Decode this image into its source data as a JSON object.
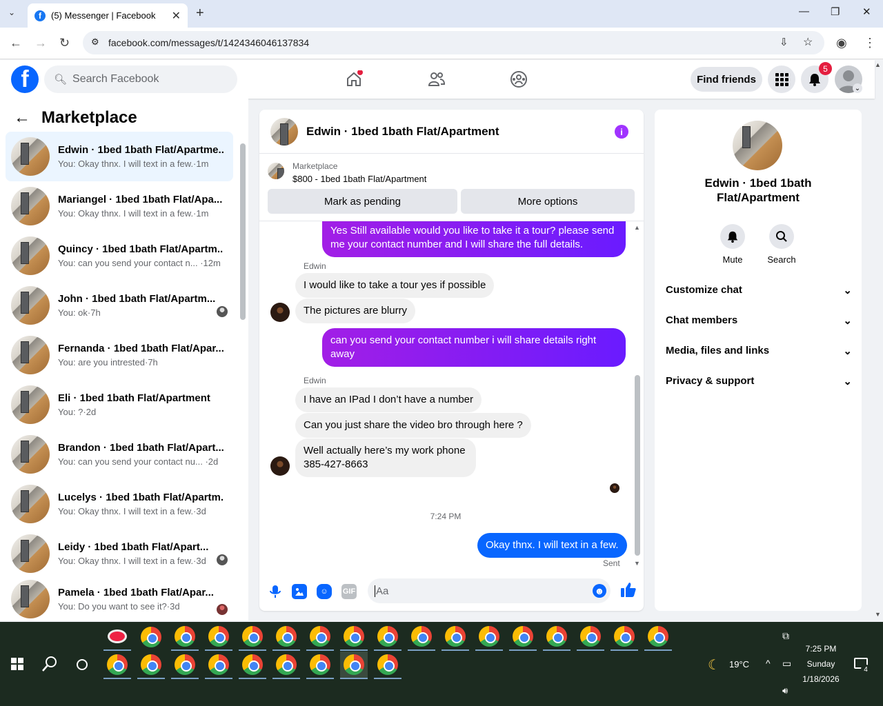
{
  "browser": {
    "tab_title": "(5) Messenger | Facebook",
    "url": "facebook.com/messages/t/1424346046137834"
  },
  "header": {
    "search_placeholder": "Search Facebook",
    "find_friends": "Find friends",
    "notification_count": "5"
  },
  "sidebar": {
    "title": "Marketplace",
    "conversations": [
      {
        "name": "Edwin · 1bed 1bath Flat/Apartme...",
        "preview": "You: Okay thnx. I will text in a few.·1m",
        "selected": true
      },
      {
        "name": "Mariangel · 1bed 1bath Flat/Apa...",
        "preview": "You: Okay thnx. I will text in a few.·1m"
      },
      {
        "name": "Quincy · 1bed 1bath Flat/Apartm...",
        "preview": "You: can you send your contact n... ·12m"
      },
      {
        "name": "John · 1bed 1bath Flat/Apartm...",
        "preview": "You: ok·7h"
      },
      {
        "name": "Fernanda · 1bed 1bath Flat/Apar...",
        "preview": "You: are you intrested·7h"
      },
      {
        "name": "Eli · 1bed 1bath Flat/Apartment",
        "preview": "You: ?·2d"
      },
      {
        "name": "Brandon · 1bed 1bath Flat/Apart...",
        "preview": "You: can you send your contact nu... ·2d"
      },
      {
        "name": "Lucelys · 1bed 1bath Flat/Apartm...",
        "preview": "You: Okay thnx. I will text in a few.·3d"
      },
      {
        "name": "Leidy · 1bed 1bath Flat/Apart...",
        "preview": "You: Okay thnx. I will text in a few.·3d"
      },
      {
        "name": "Pamela · 1bed 1bath Flat/Apar...",
        "preview": "You: Do you want to see it?·3d"
      }
    ]
  },
  "chat": {
    "title": "Edwin · 1bed 1bath Flat/Apartment",
    "marketplace_label": "Marketplace",
    "listing": "$800 - 1bed 1bath Flat/Apartment",
    "mark_pending": "Mark as pending",
    "more_options": "More options",
    "msg1": "Yes Still available would you like to take it a tour? please send me your contact number and I will share the full details.",
    "sender1": "Edwin",
    "msg2": "I would like to take a tour yes if possible",
    "msg3": "The pictures are blurry",
    "msg4": "can you send your contact number i will share details right away",
    "sender2": "Edwin",
    "msg5": "I have an IPad I don’t have a number",
    "msg6": "Can you just share the video bro through here ?",
    "msg7": "Well actually here’s my work phone 385-427-8663",
    "timestamp": "7:24 PM",
    "msg8": "Okay thnx. I will text in a few.",
    "sent": "Sent",
    "input_placeholder": "Aa"
  },
  "right_panel": {
    "name": "Edwin · 1bed 1bath Flat/Apartment",
    "mute": "Mute",
    "search": "Search",
    "sections": [
      "Customize chat",
      "Chat members",
      "Media, files and links",
      "Privacy & support"
    ]
  },
  "taskbar": {
    "weather": "19°C",
    "time": "7:25 PM",
    "day": "Sunday",
    "date": "1/18/2026",
    "notif": "4"
  }
}
